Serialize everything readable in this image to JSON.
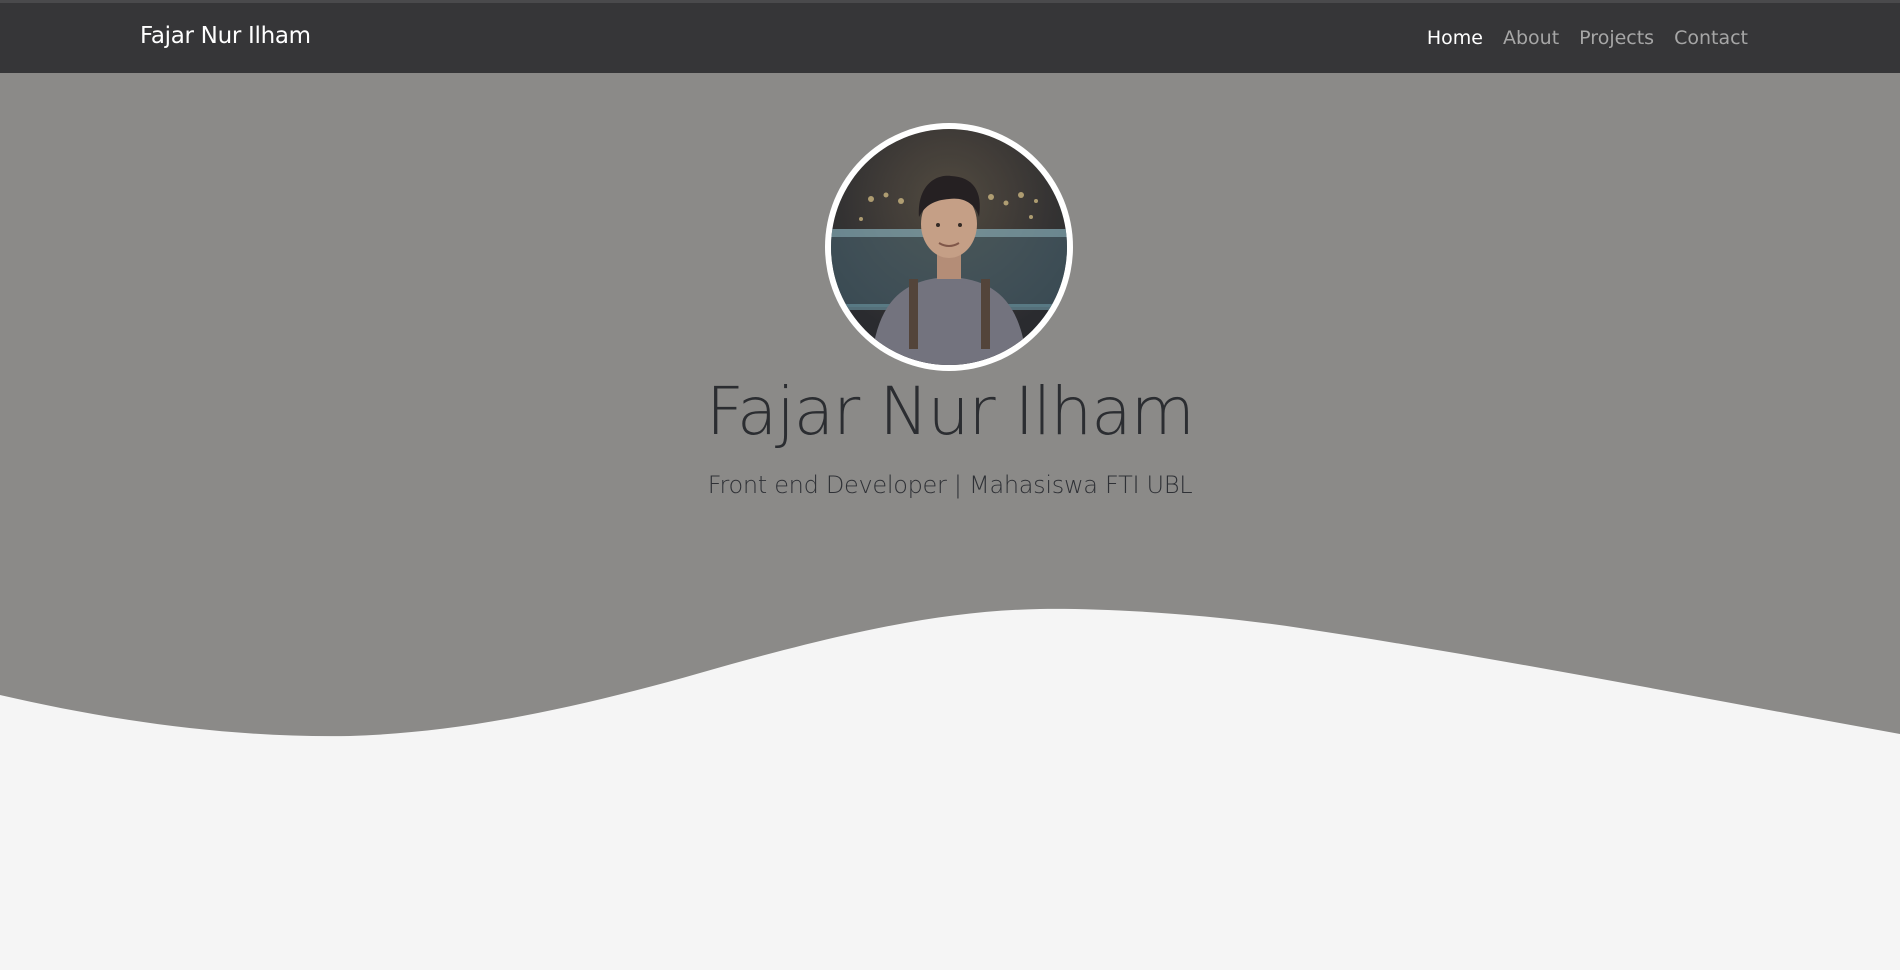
{
  "navbar": {
    "brand": "Fajar Nur Ilham",
    "links": [
      {
        "label": "Home",
        "active": true
      },
      {
        "label": "About",
        "active": false
      },
      {
        "label": "Projects",
        "active": false
      },
      {
        "label": "Contact",
        "active": false
      }
    ]
  },
  "hero": {
    "title": "Fajar Nur Ilham",
    "subtitle": "Front end Developer | Mahasiswa FTI UBL",
    "avatar_icon": "profile-photo"
  },
  "colors": {
    "navbar_bg": "#363638",
    "hero_bg": "#8b8a88",
    "page_bg": "#f5f5f5",
    "text_dark": "#2b2d31",
    "nav_active": "#ffffff",
    "nav_inactive": "#a6a6a6"
  }
}
